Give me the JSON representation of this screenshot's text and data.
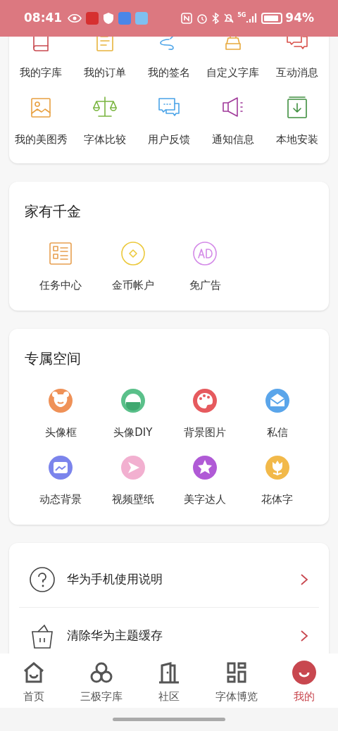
{
  "status_bar": {
    "time": "08:41",
    "network": "5G",
    "battery": "94%"
  },
  "tools": [
    {
      "label": "我的字库"
    },
    {
      "label": "我的订单"
    },
    {
      "label": "我的签名"
    },
    {
      "label": "自定义字库"
    },
    {
      "label": "互动消息"
    },
    {
      "label": "我的美图秀"
    },
    {
      "label": "字体比较"
    },
    {
      "label": "用户反馈"
    },
    {
      "label": "通知信息"
    },
    {
      "label": "本地安装"
    }
  ],
  "family": {
    "title": "家有千金",
    "items": [
      {
        "label": "任务中心"
      },
      {
        "label": "金币帐户"
      },
      {
        "label": "免广告"
      }
    ]
  },
  "space": {
    "title": "专属空间",
    "items": [
      {
        "label": "头像框"
      },
      {
        "label": "头像DIY"
      },
      {
        "label": "背景图片"
      },
      {
        "label": "私信"
      },
      {
        "label": "动态背景"
      },
      {
        "label": "视频壁纸"
      },
      {
        "label": "美字达人"
      },
      {
        "label": "花体字"
      }
    ]
  },
  "links": [
    {
      "label": "华为手机使用说明"
    },
    {
      "label": "清除华为主题缓存"
    }
  ],
  "bottom_nav": [
    {
      "label": "首页",
      "selected": false
    },
    {
      "label": "三极字库",
      "selected": false
    },
    {
      "label": "社区",
      "selected": false
    },
    {
      "label": "字体博览",
      "selected": false
    },
    {
      "label": "我的",
      "selected": true
    }
  ]
}
